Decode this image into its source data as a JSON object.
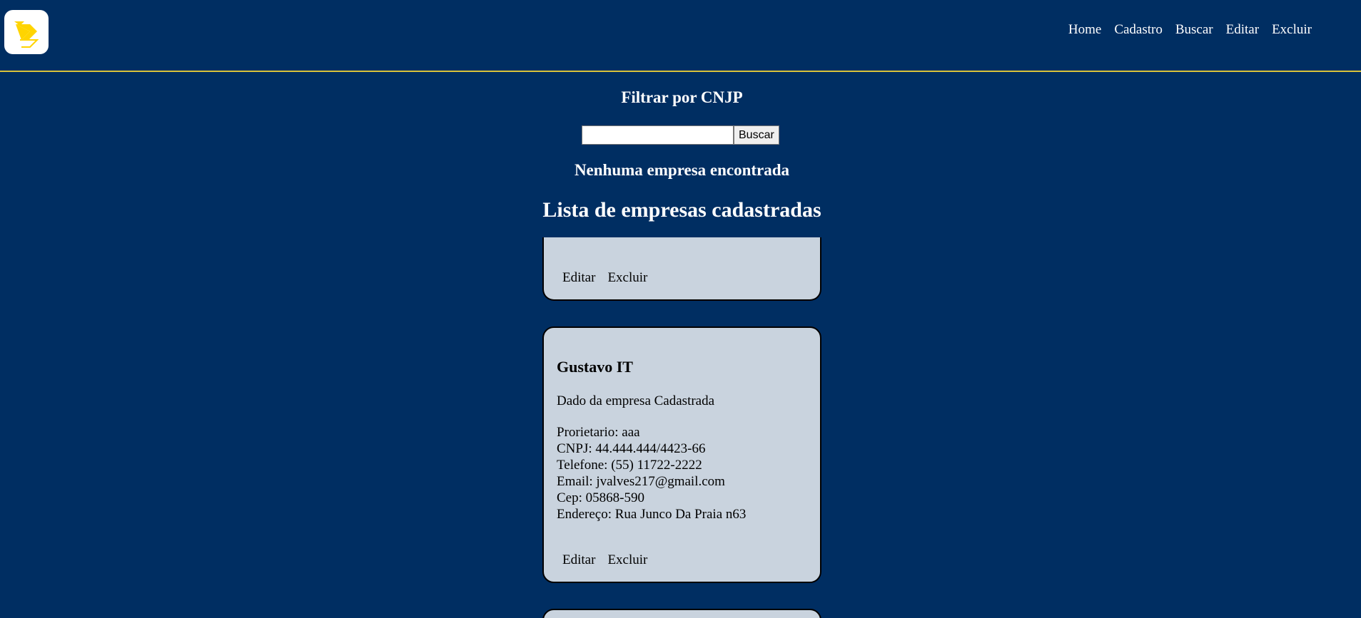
{
  "header": {
    "logo_alt": "logo",
    "nav": [
      "Home",
      "Cadastro",
      "Buscar",
      "Editar",
      "Excluir"
    ]
  },
  "filter": {
    "title": "Filtrar por CNJP",
    "input_value": "",
    "button_label": "Buscar"
  },
  "status_message": "Nenhuma empresa encontrada",
  "list_title": "Lista de empresas cadastradas",
  "cards": [
    {
      "actions": [
        "Editar",
        "Excluir"
      ]
    },
    {
      "name": "Gustavo IT",
      "subtitle": "Dado da empresa Cadastrada",
      "details": [
        "Prorietario: aaa",
        "CNPJ: 44.444.444/4423-66",
        "Telefone: (55) 11722-2222",
        "Email: jvalves217@gmail.com",
        "Cep: 05868-590",
        "Endereço: Rua Junco Da Praia n63"
      ],
      "actions": [
        "Editar",
        "Excluir"
      ]
    }
  ],
  "colors": {
    "background": "#002e62",
    "header_border": "#d9c23a",
    "card_background": "#c9d3de",
    "logo_accent": "#ffd400"
  }
}
